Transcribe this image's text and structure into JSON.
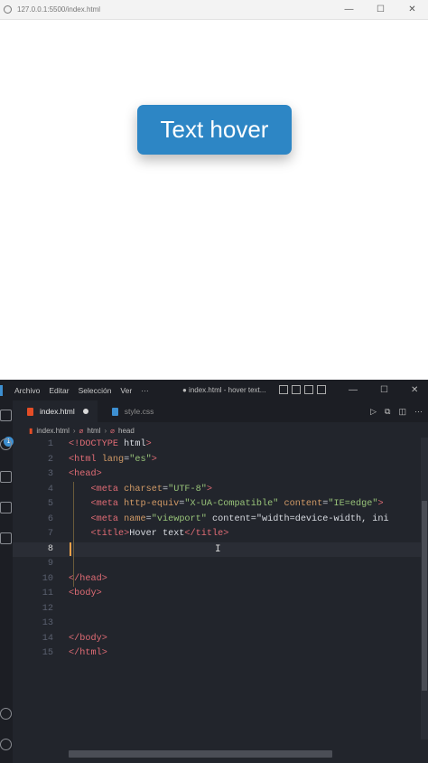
{
  "browser": {
    "url": "127.0.0.1:5500/index.html",
    "button_label": "Text hover",
    "window_controls": {
      "minimize": "—",
      "maximize": "☐",
      "close": "✕"
    }
  },
  "vscode": {
    "menu": [
      "Archivo",
      "Editar",
      "Selección",
      "Ver",
      "···"
    ],
    "window_title": "● index.html - hover text...",
    "window_controls": {
      "minimize": "—",
      "maximize": "☐",
      "close": "✕"
    },
    "activity_badge": "1",
    "tabs": [
      {
        "label": "index.html",
        "modified": true,
        "icon_color": "#e44d26"
      },
      {
        "label": "style.css",
        "modified": false,
        "icon_color": "#3d8fd1"
      }
    ],
    "breadcrumb": [
      "index.html",
      "html",
      "head"
    ],
    "current_line": 8,
    "code_lines": [
      {
        "n": "1",
        "text": "<!DOCTYPE html>"
      },
      {
        "n": "2",
        "text": "<html lang=\"es\">"
      },
      {
        "n": "3",
        "text": "<head>"
      },
      {
        "n": "4",
        "text": "    <meta charset=\"UTF-8\">"
      },
      {
        "n": "5",
        "text": "    <meta http-equiv=\"X-UA-Compatible\" content=\"IE=edge\">"
      },
      {
        "n": "6",
        "text": "    <meta name=\"viewport\" content=\"width=device-width, ini"
      },
      {
        "n": "7",
        "text": "    <title>Hover text</title>"
      },
      {
        "n": "8",
        "text": ""
      },
      {
        "n": "9",
        "text": ""
      },
      {
        "n": "10",
        "text": "</head>"
      },
      {
        "n": "11",
        "text": "<body>"
      },
      {
        "n": "12",
        "text": ""
      },
      {
        "n": "13",
        "text": ""
      },
      {
        "n": "14",
        "text": "</body>"
      },
      {
        "n": "15",
        "text": "</html>"
      }
    ]
  },
  "colors": {
    "button_bg": "#2d86c5",
    "editor_bg": "#22252c",
    "tag": "#e06c75",
    "attribute": "#d19a66",
    "string": "#98c379"
  }
}
